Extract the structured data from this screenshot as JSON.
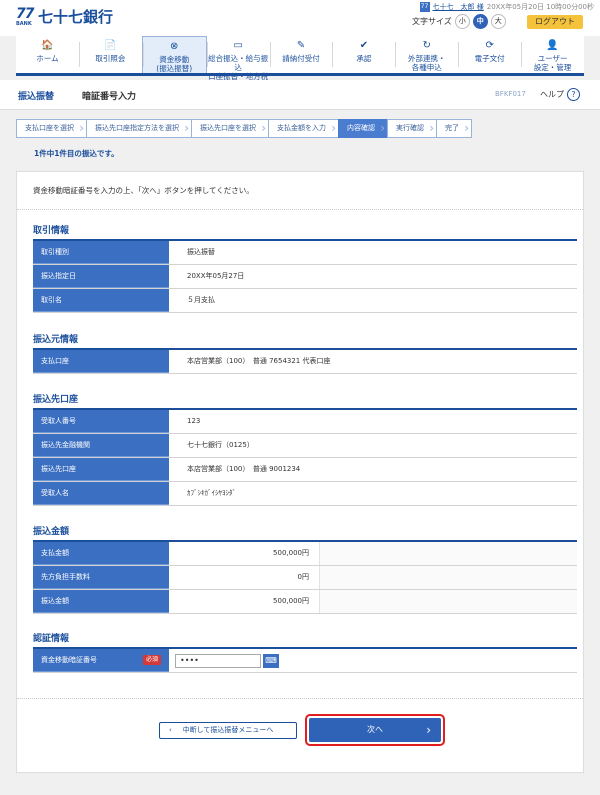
{
  "brand": {
    "mark": "77",
    "mark_sub": "BANK",
    "name": "七十七銀行"
  },
  "user": {
    "icon": "user-icon",
    "icon_glyph": "77",
    "name": "七十七　太郎 様",
    "datetime": "20XX年05月20日 10時00分00秒"
  },
  "font_size": {
    "label": "文字サイズ",
    "small": "小",
    "medium": "中",
    "large": "大"
  },
  "logout_label": "ログアウト",
  "nav": [
    {
      "label": "ホーム",
      "icon": "🏠"
    },
    {
      "label": "取引照会",
      "icon": "📄"
    },
    {
      "label": "資金移動\n(振込振替)",
      "icon": "⊗"
    },
    {
      "label": "総合振込・給与振込\n口座振替・地方税",
      "icon": "▭"
    },
    {
      "label": "請納付受付",
      "icon": "✎"
    },
    {
      "label": "承認",
      "icon": "✔"
    },
    {
      "label": "外部連携・\n各種申込",
      "icon": "↻"
    },
    {
      "label": "電子文付",
      "icon": "⟳"
    },
    {
      "label": "ユーザー\n設定・管理",
      "icon": "👤"
    }
  ],
  "page": {
    "category": "振込振替",
    "title": "暗証番号入力",
    "screen_id": "BFKF017",
    "help": "ヘルプ",
    "help_icon": "?"
  },
  "steps": [
    "支払口座を選択",
    "振込先口座指定方法を選択",
    "振込先口座を選択",
    "支払金額を入力",
    "内容確認",
    "実行確認",
    "完了"
  ],
  "active_step": "内容確認",
  "count_note": "1件中1件目の振込です。",
  "instruction": "資金移動暗証番号を入力の上、「次へ」ボタンを押してください。",
  "sections": {
    "transaction": {
      "title": "取引情報",
      "rows": [
        {
          "label": "取引種別",
          "value": "振込振替"
        },
        {
          "label": "振込指定日",
          "value": "20XX年05月27日"
        },
        {
          "label": "取引名",
          "value": "５月支払"
        }
      ]
    },
    "source": {
      "title": "振込元情報",
      "rows": [
        {
          "label": "支払口座",
          "value": "本店営業部（100）　普通 7654321 代表口座"
        }
      ]
    },
    "destination": {
      "title": "振込先口座",
      "rows": [
        {
          "label": "受取人番号",
          "value": "123"
        },
        {
          "label": "振込先金融機関",
          "value": "七十七銀行（0125）"
        },
        {
          "label": "振込先口座",
          "value": "本店営業部（100）　普通 9001234"
        },
        {
          "label": "受取人名",
          "value": "ｶﾌﾞｼｷｶﾞｲｼﾔﾖｼﾀﾞ"
        }
      ]
    },
    "amount": {
      "title": "振込金額",
      "rows": [
        {
          "label": "支払金額",
          "value": "500,000円"
        },
        {
          "label": "先方負担手数料",
          "value": "0円"
        },
        {
          "label": "振込金額",
          "value": "500,000円"
        }
      ]
    },
    "auth": {
      "title": "認証情報",
      "label": "資金移動暗証番号",
      "required": "必須",
      "password_value": "••••",
      "keyboard_icon": "⌨"
    }
  },
  "buttons": {
    "back": "中断して振込振替メニューへ",
    "next": "次へ",
    "back_chev": "‹",
    "next_chev": "›"
  }
}
